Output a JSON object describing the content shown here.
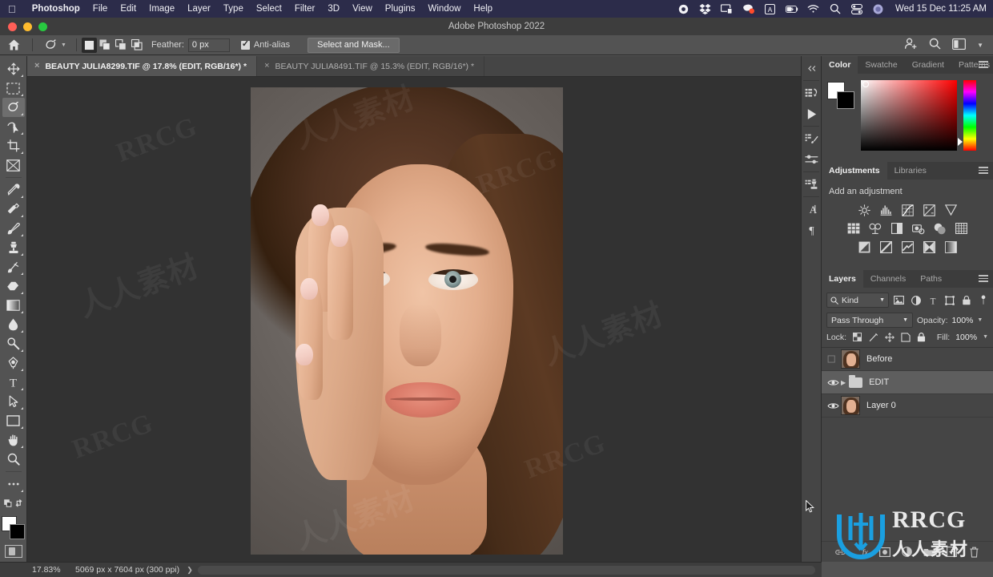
{
  "os_menu": {
    "apple_icon": "apple-logo",
    "items": [
      {
        "label": "Photoshop",
        "bold": true
      },
      {
        "label": "File",
        "bold": false
      },
      {
        "label": "Edit",
        "bold": false
      },
      {
        "label": "Image",
        "bold": false
      },
      {
        "label": "Layer",
        "bold": false
      },
      {
        "label": "Type",
        "bold": false
      },
      {
        "label": "Select",
        "bold": false
      },
      {
        "label": "Filter",
        "bold": false
      },
      {
        "label": "3D",
        "bold": false
      },
      {
        "label": "View",
        "bold": false
      },
      {
        "label": "Plugins",
        "bold": false
      },
      {
        "label": "Window",
        "bold": false
      },
      {
        "label": "Help",
        "bold": false
      }
    ],
    "status_icons": [
      "record-icon",
      "dropbox-icon",
      "display-icon",
      "app-badge-icon",
      "keyboard-layout-icon",
      "battery-charging-icon",
      "wifi-icon",
      "spotlight-search-icon",
      "control-center-icon",
      "siri-icon"
    ],
    "clock": "Wed 15 Dec  11:25 AM"
  },
  "window": {
    "title": "Adobe Photoshop 2022",
    "traffic_lights": [
      "close-button",
      "minimize-button",
      "zoom-button"
    ]
  },
  "options_bar": {
    "home_icon": "home-icon",
    "tool_icon": "lasso-tool-icon",
    "tool_dropdown_icon": "chevron-down-icon",
    "selection_modes": [
      "new-selection",
      "add-to-selection",
      "subtract-from-selection",
      "intersect-with-selection"
    ],
    "feather_label": "Feather:",
    "feather_value": "0 px",
    "antialias_label": "Anti-alias",
    "antialias_checked": true,
    "select_and_mask_label": "Select and Mask...",
    "right_icons": [
      "share-user-icon",
      "search-icon",
      "workspace-layout-icon",
      "chevron-down-icon"
    ]
  },
  "tabs": [
    {
      "title": "BEAUTY JULIA8299.TIF @ 17.8% (EDIT, RGB/16*) *",
      "active": true,
      "close_icon": "close-icon"
    },
    {
      "title": "BEAUTY JULIA8491.TIF @ 15.3% (EDIT, RGB/16*) *",
      "active": false,
      "close_icon": "close-icon"
    }
  ],
  "toolbar": {
    "tools": [
      {
        "name": "move-tool",
        "active": false,
        "has_flyout": true
      },
      {
        "name": "rectangular-marquee-tool",
        "active": false,
        "has_flyout": true
      },
      {
        "name": "lasso-tool",
        "active": true,
        "has_flyout": true
      },
      {
        "name": "object-selection-tool",
        "active": false,
        "has_flyout": true
      },
      {
        "name": "crop-tool",
        "active": false,
        "has_flyout": true
      },
      {
        "name": "frame-tool",
        "active": false,
        "has_flyout": false
      },
      {
        "name": "eyedropper-tool",
        "active": false,
        "has_flyout": true
      },
      {
        "name": "spot-healing-brush-tool",
        "active": false,
        "has_flyout": true
      },
      {
        "name": "brush-tool",
        "active": false,
        "has_flyout": true
      },
      {
        "name": "clone-stamp-tool",
        "active": false,
        "has_flyout": true
      },
      {
        "name": "history-brush-tool",
        "active": false,
        "has_flyout": true
      },
      {
        "name": "eraser-tool",
        "active": false,
        "has_flyout": true
      },
      {
        "name": "gradient-tool",
        "active": false,
        "has_flyout": true
      },
      {
        "name": "blur-tool",
        "active": false,
        "has_flyout": true
      },
      {
        "name": "dodge-tool",
        "active": false,
        "has_flyout": true
      },
      {
        "name": "pen-tool",
        "active": false,
        "has_flyout": true
      },
      {
        "name": "type-tool",
        "active": false,
        "has_flyout": true
      },
      {
        "name": "path-selection-tool",
        "active": false,
        "has_flyout": true
      },
      {
        "name": "rectangle-tool",
        "active": false,
        "has_flyout": true
      },
      {
        "name": "hand-tool",
        "active": false,
        "has_flyout": true
      },
      {
        "name": "zoom-tool",
        "active": false,
        "has_flyout": false
      },
      {
        "name": "edit-toolbar-more-tool",
        "active": false,
        "has_flyout": false
      },
      {
        "name": "default-colors-tool",
        "active": false,
        "has_flyout": false
      }
    ],
    "foreground_color": "#ffffff",
    "background_color": "#000000",
    "quick_mask": "quick-mask-mode"
  },
  "dock_icons": [
    {
      "name": "collapse-panels-icon"
    },
    {
      "name": "history-panel-icon"
    },
    {
      "name": "actions-play-icon"
    },
    {
      "name": "brush-settings-icon"
    },
    {
      "name": "brushes-presets-icon"
    },
    {
      "name": "clone-source-icon"
    },
    {
      "name": "character-panel-icon",
      "glyph": "A"
    },
    {
      "name": "paragraph-panel-icon",
      "glyph": "¶"
    }
  ],
  "color_panel": {
    "tabs": [
      {
        "label": "Color",
        "active": true
      },
      {
        "label": "Swatche",
        "active": false
      },
      {
        "label": "Gradient",
        "active": false
      },
      {
        "label": "Patterns",
        "active": false
      }
    ],
    "menu_icon": "panel-menu-icon",
    "foreground": "#ffffff",
    "background": "#000000",
    "hue": "#ff0000"
  },
  "adjustments_panel": {
    "tabs": [
      {
        "label": "Adjustments",
        "active": true
      },
      {
        "label": "Libraries",
        "active": false
      }
    ],
    "menu_icon": "panel-menu-icon",
    "heading": "Add an adjustment",
    "rows": [
      [
        "brightness-contrast-icon",
        "levels-icon",
        "curves-icon",
        "exposure-icon",
        "vibrance-icon"
      ],
      [
        "hue-saturation-icon",
        "color-balance-icon",
        "black-and-white-icon",
        "photo-filter-icon",
        "channel-mixer-icon",
        "color-lookup-icon"
      ],
      [
        "invert-icon",
        "posterize-icon",
        "threshold-icon",
        "selective-color-icon",
        "gradient-map-icon"
      ]
    ]
  },
  "layers_panel": {
    "tabs": [
      {
        "label": "Layers",
        "active": true
      },
      {
        "label": "Channels",
        "active": false
      },
      {
        "label": "Paths",
        "active": false
      }
    ],
    "menu_icon": "panel-menu-icon",
    "filter_label": "Kind",
    "filter_search_icon": "search-icon",
    "filter_chevron": "chevron-down-icon",
    "filter_type_icons": [
      "filter-pixel-icon",
      "filter-adjustment-icon",
      "filter-type-icon",
      "filter-shape-icon",
      "filter-smart-object-icon"
    ],
    "filter_toggle": "filter-enable-toggle",
    "blend_mode": "Pass Through",
    "blend_chevron": "chevron-down-icon",
    "opacity_label": "Opacity:",
    "opacity_value": "100%",
    "opacity_chevron": "chevron-down-icon",
    "lock_label": "Lock:",
    "lock_icons": [
      "lock-transparent-pixels-icon",
      "lock-image-pixels-icon",
      "lock-position-icon",
      "lock-artboard-nesting-icon",
      "lock-all-icon"
    ],
    "fill_label": "Fill:",
    "fill_value": "100%",
    "fill_chevron": "chevron-down-icon",
    "layers": [
      {
        "name": "Before",
        "visible": false,
        "selected": false,
        "type": "image",
        "expand_icon": null
      },
      {
        "name": "EDIT",
        "visible": true,
        "selected": true,
        "type": "group",
        "expand_icon": "chevron-right-icon"
      },
      {
        "name": "Layer 0",
        "visible": true,
        "selected": false,
        "type": "image",
        "expand_icon": null
      }
    ],
    "footer_icons": [
      "link-layers-icon",
      "add-layer-style-icon",
      "add-layer-mask-icon",
      "new-adjustment-layer-icon",
      "new-group-icon",
      "new-layer-icon",
      "delete-layer-icon"
    ]
  },
  "status_bar": {
    "zoom": "17.83%",
    "document_size": "5069 px x 7604 px (300 ppi)",
    "expand_icon": "chevron-right-icon"
  },
  "canvas": {
    "image_alt": "beauty-portrait-photo",
    "watermark_en": "RRCG",
    "watermark_cn": "人人素材",
    "cursor": "arrow-cursor"
  },
  "logo_overlay": {
    "badge": "rrcg-logo-badge",
    "text_en": "RRCG",
    "text_cn": "人人素材"
  },
  "colors": {
    "menubar_bg": "#2c2c4a",
    "panel_bg": "#454545",
    "app_bg": "#535353",
    "canvas_bg": "#323232",
    "accent_blue": "#1a9fe0",
    "selected_row": "#5e5e5e"
  }
}
